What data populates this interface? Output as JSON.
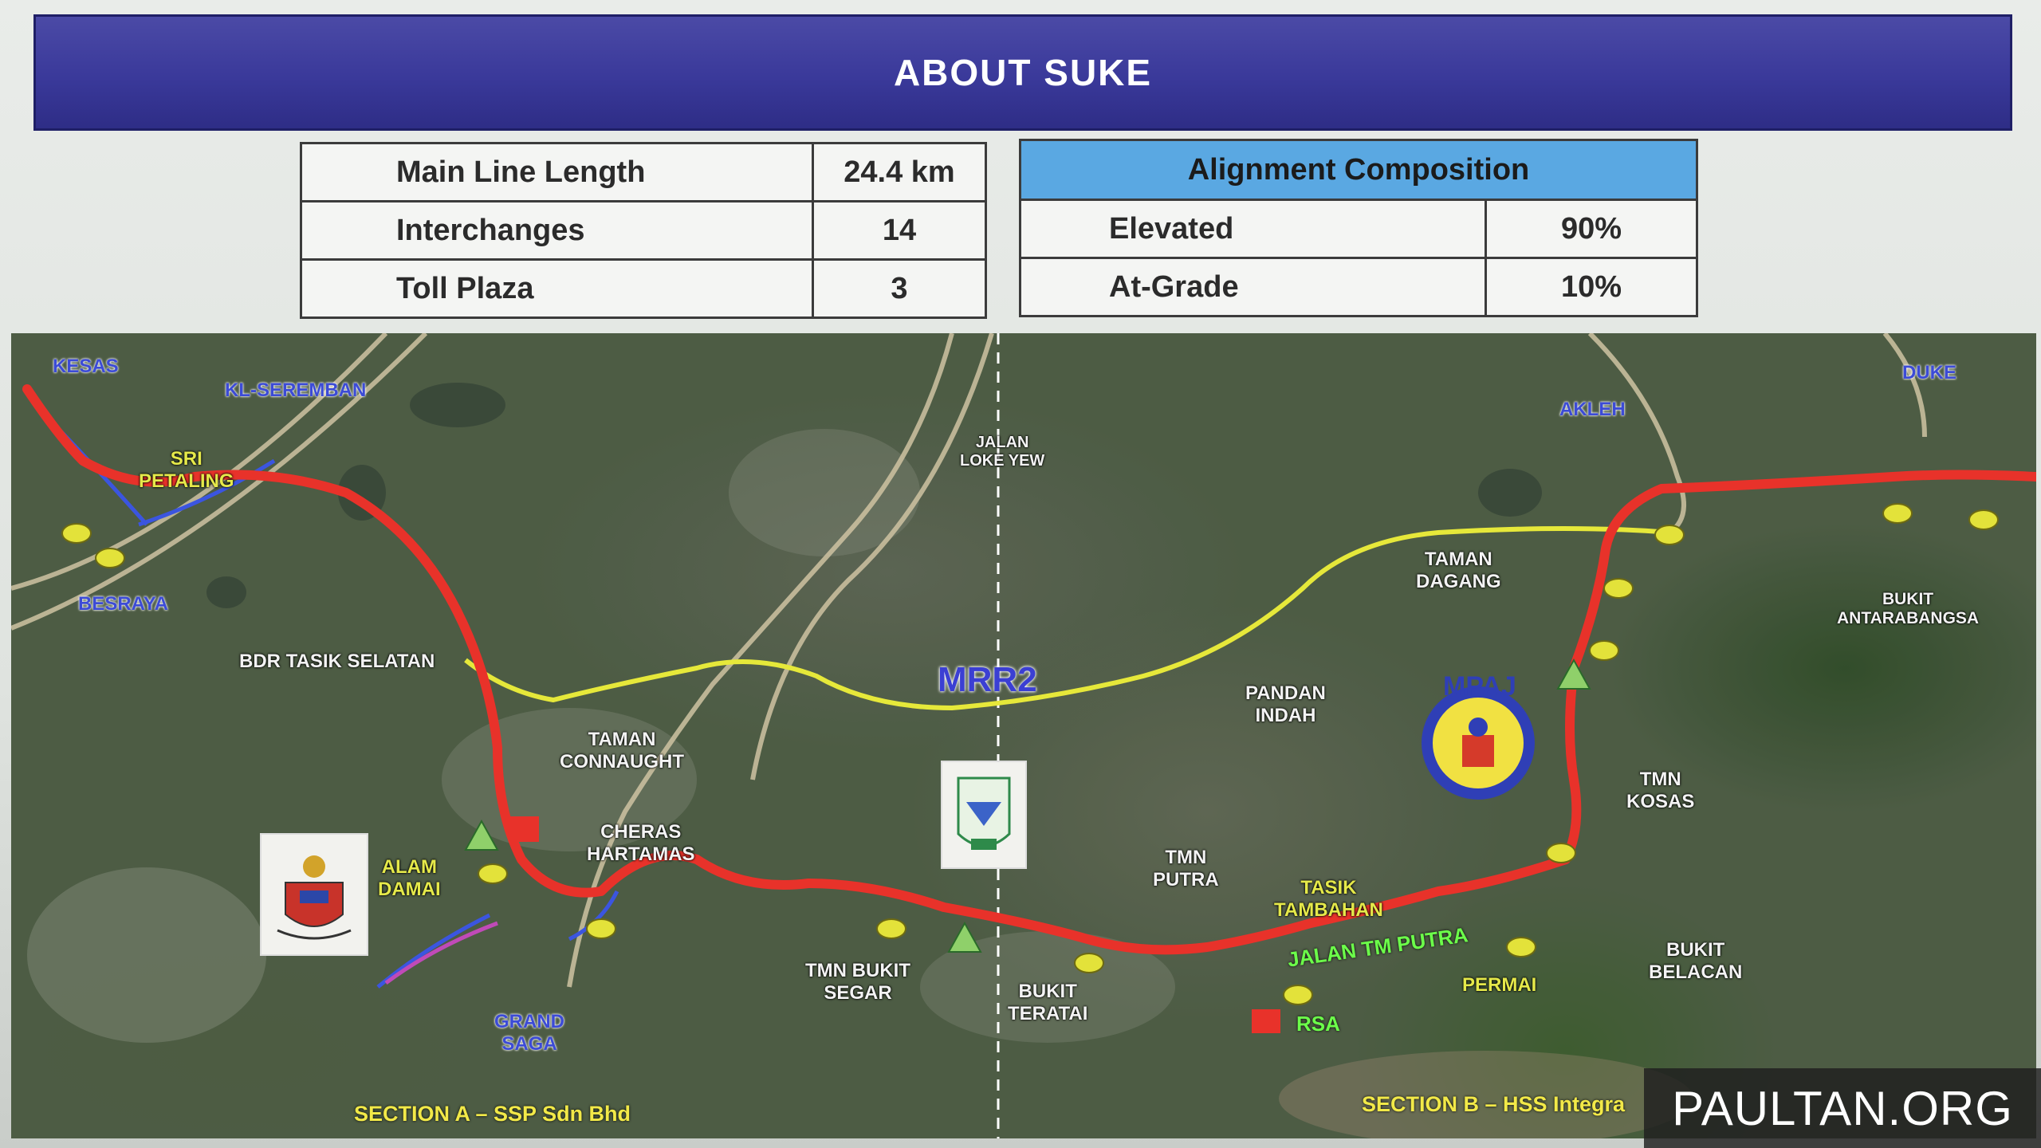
{
  "slide": {
    "title": "ABOUT SUKE"
  },
  "stats": [
    {
      "label": "Main Line Length",
      "value": "24.4 km"
    },
    {
      "label": "Interchanges",
      "value": "14"
    },
    {
      "label": "Toll Plaza",
      "value": "3"
    }
  ],
  "alignment": {
    "header": "Alignment Composition",
    "rows": [
      {
        "label": "Elevated",
        "value": "90%"
      },
      {
        "label": "At-Grade",
        "value": "10%"
      }
    ]
  },
  "map": {
    "highways": {
      "kesas": "KESAS",
      "kl_seremban": "KL-SEREMBAN",
      "besraya": "BESRAYA",
      "akleh": "AKLEH",
      "duke": "DUKE",
      "mrr2": "MRR2",
      "jalan_tm_putra": "JALAN TM PUTRA"
    },
    "places": {
      "sri_petaling": "SRI\nPETALING",
      "jalan_loke_yew": "JALAN\nLOKE YEW",
      "bdr_tasik_selatan": "BDR TASIK SELATAN",
      "taman_connaught": "TAMAN\nCONNAUGHT",
      "cheras_hartamas": "CHERAS\nHARTAMAS",
      "alam_damai": "ALAM\nDAMAI",
      "grand_saga": "GRAND\nSAGA",
      "tmn_bukit_segar": "TMN BUKIT\nSEGAR",
      "bukit_teratai": "BUKIT\nTERATAI",
      "tmn_putra": "TMN\nPUTRA",
      "tasik_tambahan": "TASIK\nTAMBAHAN",
      "pandan_indah": "PANDAN\nINDAH",
      "taman_dagang": "TAMAN\nDAGANG",
      "bukit_antarabangsa": "BUKIT\nANTARABANGSA",
      "tmn_kosas": "TMN\nKOSAS",
      "permai": "PERMAI",
      "bukit_belacan": "BUKIT\nBELACAN",
      "rsa": "RSA"
    },
    "sections": {
      "a": "SECTION A – SSP Sdn Bhd",
      "b": "SECTION B – HSS Integra"
    },
    "logos": {
      "mpaj_text": "MPAJ"
    },
    "colors": {
      "suke_route": "#e8322a",
      "mrr2_road": "#e6e83a",
      "interchange": "#e3e23a",
      "toll_plaza": "#8fd06a",
      "rsa": "#e8322a"
    }
  },
  "watermark": "PAULTAN.ORG"
}
